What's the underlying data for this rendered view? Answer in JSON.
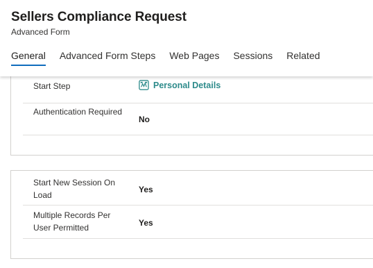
{
  "header": {
    "title": "Sellers Compliance Request",
    "subtitle": "Advanced Form"
  },
  "tabs": [
    {
      "label": "General",
      "active": true
    },
    {
      "label": "Advanced Form Steps",
      "active": false
    },
    {
      "label": "Web Pages",
      "active": false
    },
    {
      "label": "Sessions",
      "active": false
    },
    {
      "label": "Related",
      "active": false
    }
  ],
  "section1": {
    "rows": [
      {
        "label": "Start Step",
        "value": "Personal Details",
        "icon": "form-step-icon"
      },
      {
        "label": "Authentication Required",
        "value": "No"
      }
    ]
  },
  "section2": {
    "rows": [
      {
        "label": "Start New Session On Load",
        "value": "Yes"
      },
      {
        "label": "Multiple Records Per User Permitted",
        "value": "Yes"
      }
    ]
  },
  "colors": {
    "accent": "#0f6cbd",
    "link": "#2e8b8b",
    "border": "#d2d0ce"
  }
}
